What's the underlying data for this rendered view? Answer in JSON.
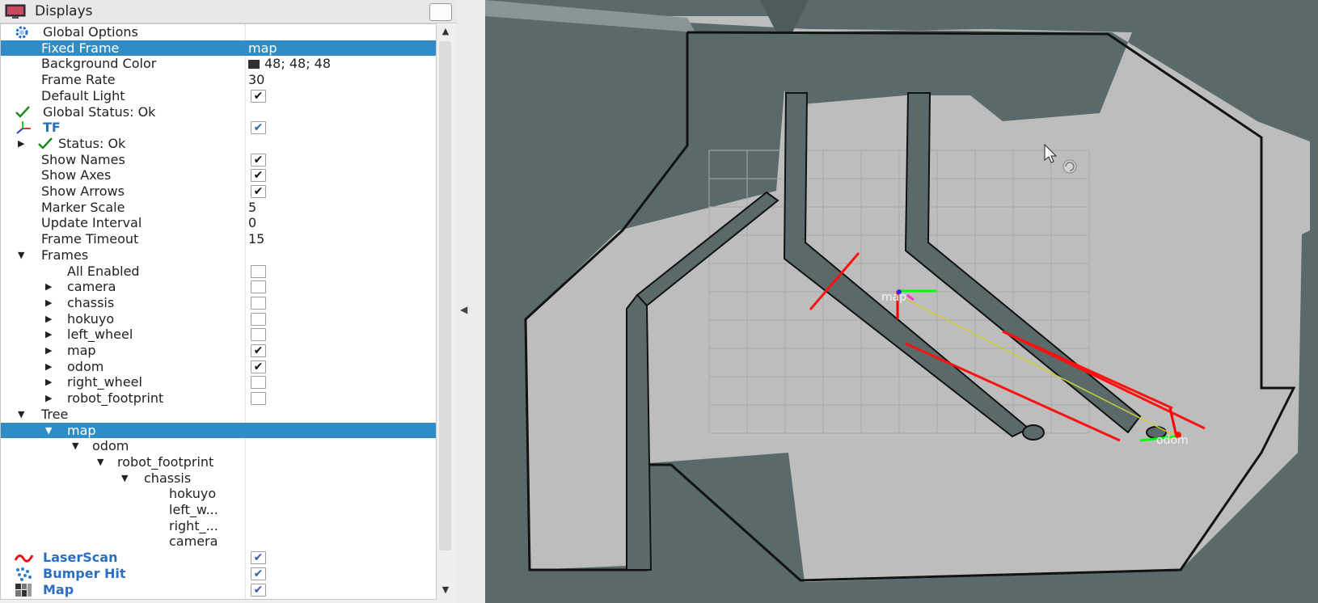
{
  "panel": {
    "title": "Displays",
    "icons": {
      "title": "monitor-icon",
      "float": "float-window-icon"
    }
  },
  "tree": [
    {
      "id": "global-options",
      "label": "Global Options",
      "indent": 1,
      "icon": "gear-icon"
    },
    {
      "id": "fixed-frame",
      "label": "Fixed Frame",
      "indent": 2,
      "value": "map",
      "selected": true
    },
    {
      "id": "background-color",
      "label": "Background Color",
      "indent": 2,
      "value": "48; 48; 48",
      "swatch": "#303030"
    },
    {
      "id": "frame-rate",
      "label": "Frame Rate",
      "indent": 2,
      "value": "30"
    },
    {
      "id": "default-light",
      "label": "Default Light",
      "indent": 2,
      "checkbox": true
    },
    {
      "id": "global-status",
      "label": "Global Status: Ok",
      "indent": 1,
      "icon": "check-icon"
    },
    {
      "id": "tf",
      "label": "TF",
      "indent": 1,
      "icon": "tf-axes-icon",
      "checkbox": true,
      "style": "display",
      "checkColor": "blue"
    },
    {
      "id": "tf-status",
      "label": "Status: Ok",
      "indent": 2,
      "icon": "check-icon",
      "arrow": "collapsed"
    },
    {
      "id": "show-names",
      "label": "Show Names",
      "indent": 2,
      "checkbox": true
    },
    {
      "id": "show-axes",
      "label": "Show Axes",
      "indent": 2,
      "checkbox": true
    },
    {
      "id": "show-arrows",
      "label": "Show Arrows",
      "indent": 2,
      "checkbox": true
    },
    {
      "id": "marker-scale",
      "label": "Marker Scale",
      "indent": 2,
      "value": "5"
    },
    {
      "id": "update-interval",
      "label": "Update Interval",
      "indent": 2,
      "value": "0"
    },
    {
      "id": "frame-timeout",
      "label": "Frame Timeout",
      "indent": 2,
      "value": "15"
    },
    {
      "id": "frames",
      "label": "Frames",
      "indent": 2,
      "arrow": "expanded"
    },
    {
      "id": "all-enabled",
      "label": "All Enabled",
      "indent": 3,
      "checkbox": false
    },
    {
      "id": "frame-camera",
      "label": "camera",
      "indent": 3,
      "arrow": "collapsed",
      "checkbox": false
    },
    {
      "id": "frame-chassis",
      "label": "chassis",
      "indent": 3,
      "arrow": "collapsed",
      "checkbox": false
    },
    {
      "id": "frame-hokuyo",
      "label": "hokuyo",
      "indent": 3,
      "arrow": "collapsed",
      "checkbox": false
    },
    {
      "id": "frame-left-wheel",
      "label": "left_wheel",
      "indent": 3,
      "arrow": "collapsed",
      "checkbox": false
    },
    {
      "id": "frame-map",
      "label": "map",
      "indent": 3,
      "arrow": "collapsed",
      "checkbox": true
    },
    {
      "id": "frame-odom",
      "label": "odom",
      "indent": 3,
      "arrow": "collapsed",
      "checkbox": true
    },
    {
      "id": "frame-right-wheel",
      "label": "right_wheel",
      "indent": 3,
      "arrow": "collapsed",
      "checkbox": false
    },
    {
      "id": "frame-robot-footprint",
      "label": "robot_footprint",
      "indent": 3,
      "arrow": "collapsed",
      "checkbox": false
    },
    {
      "id": "tree-group",
      "label": "Tree",
      "indent": 2,
      "arrow": "expanded"
    },
    {
      "id": "tree-map",
      "label": "map",
      "indent": 3,
      "arrow": "expanded",
      "selected": true
    },
    {
      "id": "tree-odom",
      "label": "odom",
      "indent": 4,
      "arrow": "expanded"
    },
    {
      "id": "tree-robot-footprint",
      "label": "robot_footprint",
      "indent": 5,
      "arrow": "expanded"
    },
    {
      "id": "tree-chassis",
      "label": "chassis",
      "indent": 6,
      "arrow": "expanded"
    },
    {
      "id": "tree-hokuyo",
      "label": "hokuyo",
      "indent": 7
    },
    {
      "id": "tree-left-wheel",
      "label": "left_w...",
      "indent": 7
    },
    {
      "id": "tree-right",
      "label": "right_...",
      "indent": 7
    },
    {
      "id": "tree-camera",
      "label": "camera",
      "indent": 7
    },
    {
      "id": "laserscan",
      "label": "LaserScan",
      "indent": 1,
      "icon": "laserscan-icon",
      "checkbox": true,
      "style": "display",
      "checkColor": "blue"
    },
    {
      "id": "bumper-hit",
      "label": "Bumper Hit",
      "indent": 1,
      "icon": "pointcloud-icon",
      "checkbox": true,
      "style": "display",
      "checkColor": "blue"
    },
    {
      "id": "map-display",
      "label": "Map",
      "indent": 1,
      "icon": "map-icon",
      "checkbox": true,
      "style": "display",
      "checkColor": "blue"
    }
  ],
  "scrollbar": {
    "up": "▲",
    "down": "▼"
  },
  "splitter": {
    "glyph": "◀"
  },
  "viewport": {
    "frame_labels": {
      "map": "map",
      "odom": "odom"
    },
    "colors": {
      "background": "#5a6a6a",
      "free_space": "#bdbdbd",
      "obstacle": "#111111",
      "laser": "#ff1010",
      "axis_x": "#ff0000",
      "axis_y": "#00ff00",
      "axis_z": "#2a2aff",
      "tf_link": "#cccc33"
    },
    "icons": {
      "cursor": "mouse-cursor-icon",
      "rotate": "rotate-icon"
    }
  }
}
